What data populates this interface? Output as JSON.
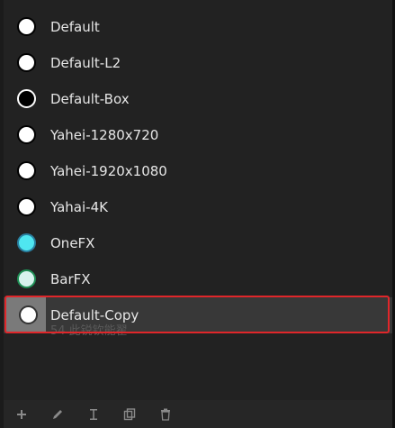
{
  "profiles": [
    {
      "label": "Default",
      "swatch_color": "#ffffff"
    },
    {
      "label": "Default-L2",
      "swatch_color": "#ffffff"
    },
    {
      "label": "Default-Box",
      "swatch_color": "#000000"
    },
    {
      "label": "Yahei-1280x720",
      "swatch_color": "#ffffff"
    },
    {
      "label": "Yahei-1920x1080",
      "swatch_color": "#ffffff"
    },
    {
      "label": "Yahai-4K",
      "swatch_color": "#ffffff"
    },
    {
      "label": "OneFX",
      "swatch_color": "#4fe6f0"
    },
    {
      "label": "BarFX",
      "swatch_color": "#d7f3ee"
    },
    {
      "label": "Default-Copy",
      "swatch_color": "#ffffff",
      "selected": true,
      "subtext": "54 此锐钦能翟"
    }
  ],
  "toolbar": {
    "buttons": [
      {
        "name": "add-button",
        "icon": "plus-icon"
      },
      {
        "name": "edit-button",
        "icon": "pencil-icon"
      },
      {
        "name": "rename-button",
        "icon": "text-cursor-icon"
      },
      {
        "name": "duplicate-button",
        "icon": "copy-icon"
      },
      {
        "name": "delete-button",
        "icon": "trash-icon"
      }
    ]
  },
  "colors": {
    "highlight": "#e0262a",
    "outline_onefx": "#2a7fa0",
    "outline_barfx": "#1f8f55"
  }
}
